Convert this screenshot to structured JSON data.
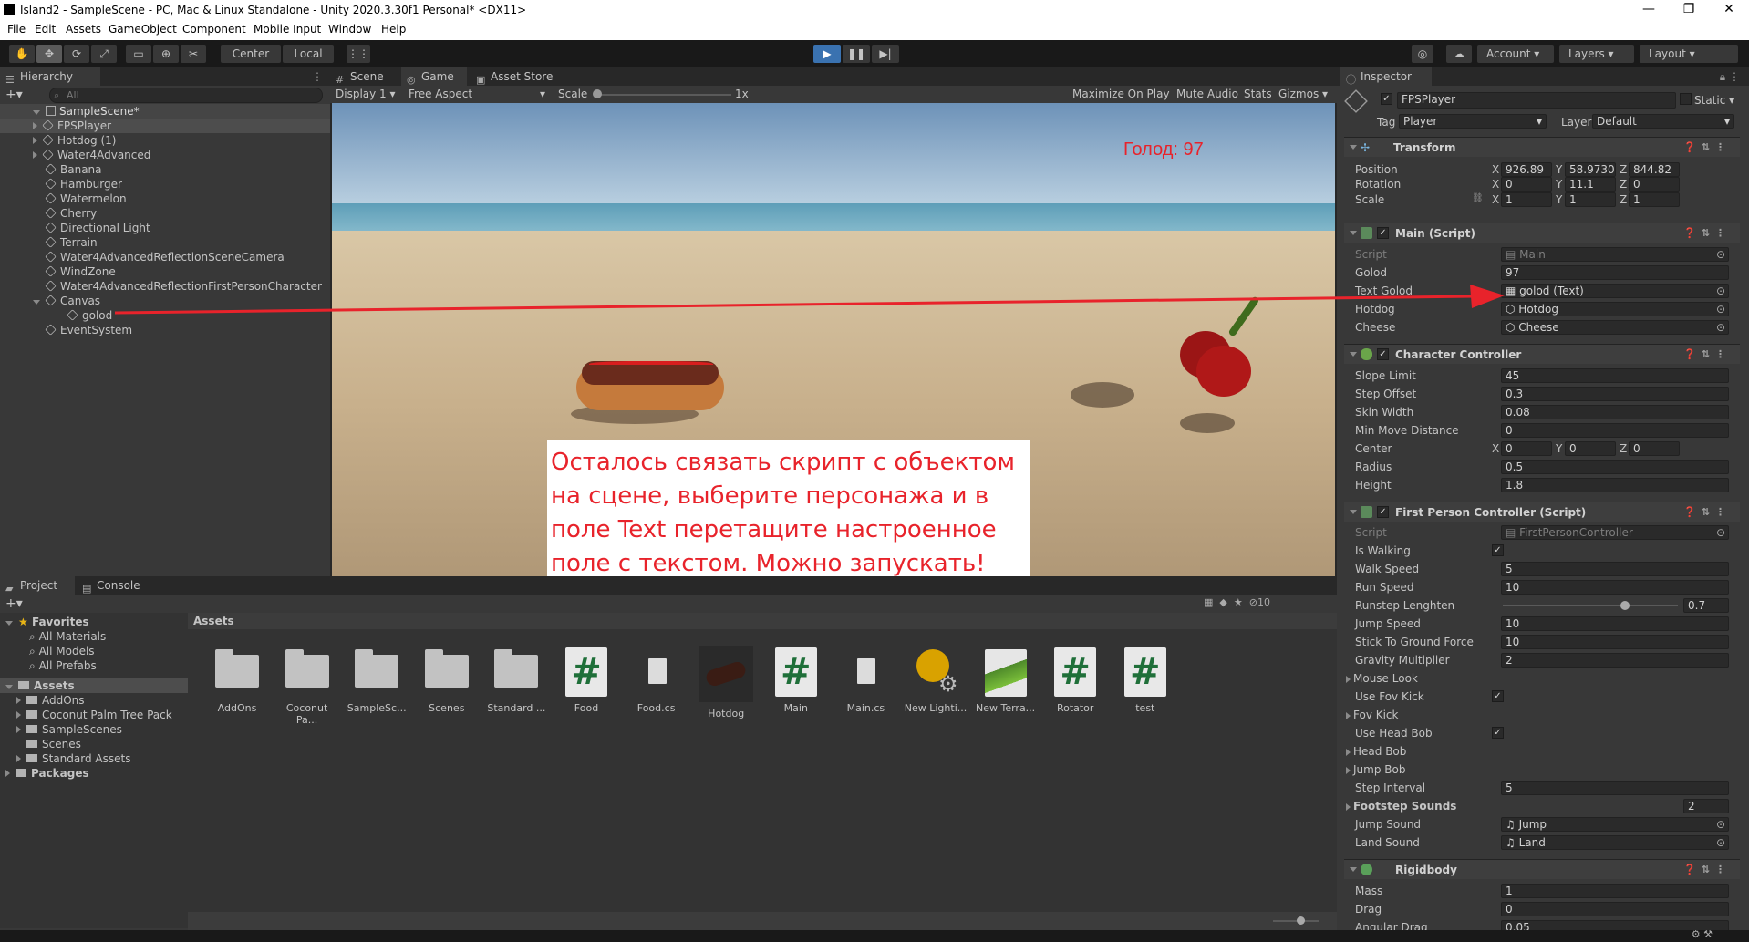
{
  "window": {
    "title": "Island2 - SampleScene - PC, Mac & Linux Standalone - Unity 2020.3.30f1 Personal* <DX11>",
    "minimize": "—",
    "maximize": "❐",
    "close": "✕"
  },
  "menu": [
    "File",
    "Edit",
    "Assets",
    "GameObject",
    "Component",
    "Mobile Input",
    "Window",
    "Help"
  ],
  "toolbar": {
    "pivot": "Center",
    "space": "Local",
    "account": "Account",
    "layers": "Layers",
    "layout": "Layout"
  },
  "hierarchy": {
    "tab": "Hierarchy",
    "search_placeholder": "All",
    "scene": "SampleScene*",
    "items": [
      {
        "label": "FPSPlayer",
        "expandable": true,
        "indent": 1,
        "selected": true
      },
      {
        "label": "Hotdog (1)",
        "expandable": true,
        "indent": 1
      },
      {
        "label": "Water4Advanced",
        "expandable": true,
        "indent": 1
      },
      {
        "label": "Banana",
        "expandable": false,
        "indent": 1
      },
      {
        "label": "Hamburger",
        "expandable": false,
        "indent": 1
      },
      {
        "label": "Watermelon",
        "expandable": false,
        "indent": 1
      },
      {
        "label": "Cherry",
        "expandable": false,
        "indent": 1
      },
      {
        "label": "Directional Light",
        "expandable": false,
        "indent": 1
      },
      {
        "label": "Terrain",
        "expandable": false,
        "indent": 1
      },
      {
        "label": "Water4AdvancedReflectionSceneCamera",
        "expandable": false,
        "indent": 1
      },
      {
        "label": "WindZone",
        "expandable": false,
        "indent": 1
      },
      {
        "label": "Water4AdvancedReflectionFirstPersonCharacter",
        "expandable": false,
        "indent": 1
      },
      {
        "label": "Canvas",
        "expandable": true,
        "expanded": true,
        "indent": 1
      },
      {
        "label": "golod",
        "expandable": false,
        "indent": 2
      },
      {
        "label": "EventSystem",
        "expandable": false,
        "indent": 1
      }
    ]
  },
  "game_view": {
    "tabs": [
      "Scene",
      "Game",
      "Asset Store"
    ],
    "display": "Display 1",
    "aspect": "Free Aspect",
    "scale_label": "Scale",
    "scale_value": "1x",
    "right_options": [
      "Maximize On Play",
      "Mute Audio",
      "Stats",
      "Gizmos"
    ],
    "hud_text": "Голод: 97",
    "instruction": "Осталось связать скрипт с объектом на сцене, выберите персонажа и в поле Text перетащите настроенное поле с текстом. Можно запускать!"
  },
  "project": {
    "tabs": [
      "Project",
      "Console"
    ],
    "favorites_label": "Favorites",
    "favorites": [
      "All Materials",
      "All Models",
      "All Prefabs"
    ],
    "assets_label": "Assets",
    "asset_folders": [
      "AddOns",
      "Coconut Palm Tree Pack",
      "SampleScenes",
      "Scenes",
      "Standard Assets"
    ],
    "packages_label": "Packages",
    "breadcrumb": "Assets",
    "hidden_count": "10",
    "assets": [
      {
        "name": "AddOns",
        "kind": "folder"
      },
      {
        "name": "Coconut Pa...",
        "kind": "folder"
      },
      {
        "name": "SampleSc...",
        "kind": "folder"
      },
      {
        "name": "Scenes",
        "kind": "folder"
      },
      {
        "name": "Standard ...",
        "kind": "folder"
      },
      {
        "name": "Food",
        "kind": "script"
      },
      {
        "name": "Food.cs",
        "kind": "doc"
      },
      {
        "name": "Hotdog",
        "kind": "model"
      },
      {
        "name": "Main",
        "kind": "script"
      },
      {
        "name": "Main.cs",
        "kind": "doc"
      },
      {
        "name": "New Lighti...",
        "kind": "lighting"
      },
      {
        "name": "New Terra...",
        "kind": "terrain"
      },
      {
        "name": "Rotator",
        "kind": "script"
      },
      {
        "name": "test",
        "kind": "script"
      }
    ]
  },
  "inspector": {
    "tab": "Inspector",
    "object_name": "FPSPlayer",
    "static_label": "Static",
    "tag_label": "Tag",
    "tag_value": "Player",
    "layer_label": "Layer",
    "layer_value": "Default",
    "transform": {
      "title": "Transform",
      "position": {
        "label": "Position",
        "x": "926.89",
        "y": "58.97304",
        "z": "844.82"
      },
      "rotation": {
        "label": "Rotation",
        "x": "0",
        "y": "11.1",
        "z": "0"
      },
      "scale": {
        "label": "Scale",
        "x": "1",
        "y": "1",
        "z": "1"
      }
    },
    "main_script": {
      "title": "Main (Script)",
      "rows": [
        {
          "label": "Script",
          "value": "Main",
          "disabled": true
        },
        {
          "label": "Golod",
          "value": "97"
        },
        {
          "label": "Text Golod",
          "value": "golod (Text)"
        },
        {
          "label": "Hotdog",
          "value": "Hotdog"
        },
        {
          "label": "Cheese",
          "value": "Cheese"
        }
      ]
    },
    "character_controller": {
      "title": "Character Controller",
      "rows": [
        {
          "label": "Slope Limit",
          "value": "45"
        },
        {
          "label": "Step Offset",
          "value": "0.3"
        },
        {
          "label": "Skin Width",
          "value": "0.08"
        },
        {
          "label": "Min Move Distance",
          "value": "0"
        },
        {
          "label": "Radius",
          "value": "0.5"
        },
        {
          "label": "Height",
          "value": "1.8"
        }
      ],
      "center": {
        "label": "Center",
        "x": "0",
        "y": "0",
        "z": "0"
      }
    },
    "fps_controller": {
      "title": "First Person Controller (Script)",
      "script_label": "Script",
      "script_value": "FirstPersonController",
      "is_walking": "Is Walking",
      "walk_speed": {
        "label": "Walk Speed",
        "value": "5"
      },
      "run_speed": {
        "label": "Run Speed",
        "value": "10"
      },
      "runstep": {
        "label": "Runstep Lenghten",
        "value": "0.7",
        "fraction": 0.7
      },
      "jump_speed": {
        "label": "Jump Speed",
        "value": "10"
      },
      "stick": {
        "label": "Stick To Ground Force",
        "value": "10"
      },
      "gravity": {
        "label": "Gravity Multiplier",
        "value": "2"
      },
      "mouse_look": "Mouse Look",
      "use_fov_kick": "Use Fov Kick",
      "fov_kick": "Fov Kick",
      "use_head_bob": "Use Head Bob",
      "head_bob": "Head Bob",
      "jump_bob": "Jump Bob",
      "step_interval": {
        "label": "Step Interval",
        "value": "5"
      },
      "footstep": {
        "label": "Footstep Sounds",
        "value": "2"
      },
      "jump_sound": {
        "label": "Jump Sound",
        "value": "Jump"
      },
      "land_sound": {
        "label": "Land Sound",
        "value": "Land"
      }
    },
    "rigidbody": {
      "title": "Rigidbody",
      "mass": {
        "label": "Mass",
        "value": "1"
      },
      "drag": {
        "label": "Drag",
        "value": "0"
      },
      "angular_drag": {
        "label": "Angular Drag",
        "value": "0.05"
      }
    }
  },
  "colors": {
    "accent_red": "#e8232b",
    "play_blue": "#3a72b0",
    "script_green": "#1f6f39"
  }
}
